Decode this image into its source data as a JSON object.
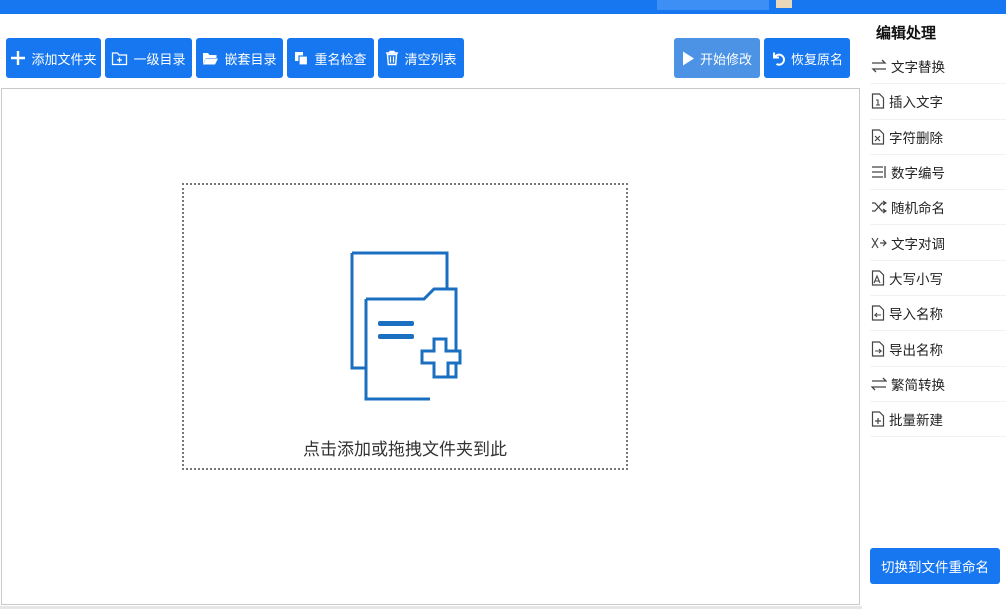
{
  "toolbar": {
    "add_folder": "添加文件夹",
    "level1_dir": "一级目录",
    "nested_dir": "嵌套目录",
    "dup_check": "重名检查",
    "clear_list": "清空列表",
    "start_modify": "开始修改",
    "restore_name": "恢复原名"
  },
  "dropzone": {
    "hint": "点击添加或拖拽文件夹到此"
  },
  "panel": {
    "title": "编辑处理",
    "items": [
      {
        "label": "文字替换",
        "icon": "swap-arrows-icon"
      },
      {
        "label": "插入文字",
        "icon": "insert-doc-icon"
      },
      {
        "label": "字符删除",
        "icon": "delete-doc-icon"
      },
      {
        "label": "数字编号",
        "icon": "number-list-icon"
      },
      {
        "label": "随机命名",
        "icon": "shuffle-icon"
      },
      {
        "label": "文字对调",
        "icon": "exchange-icon"
      },
      {
        "label": "大写小写",
        "icon": "case-icon"
      },
      {
        "label": "导入名称",
        "icon": "import-icon"
      },
      {
        "label": "导出名称",
        "icon": "export-icon"
      },
      {
        "label": "繁简转换",
        "icon": "convert-arrows-icon"
      },
      {
        "label": "批量新建",
        "icon": "new-doc-icon"
      }
    ],
    "switch_button": "切换到文件重命名"
  },
  "colors": {
    "accent": "#1677f0",
    "accent_dim": "#4c93e6",
    "icon_blue": "#1a6fc0"
  }
}
